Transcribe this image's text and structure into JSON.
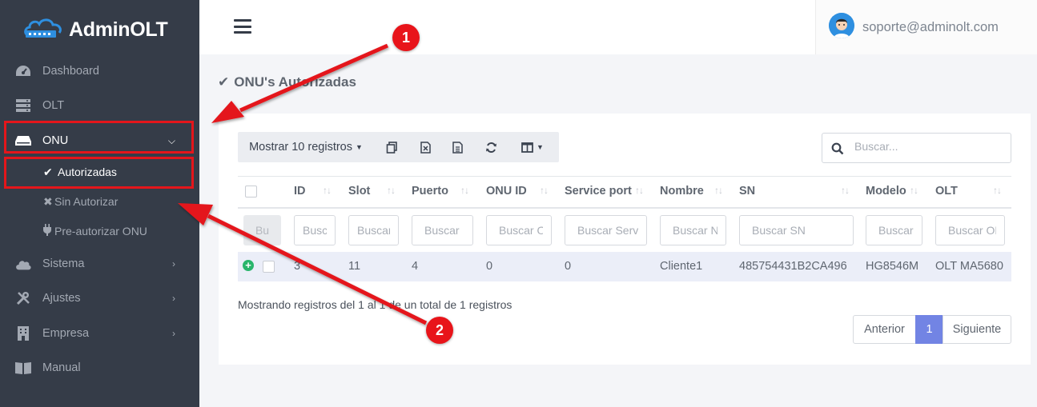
{
  "brand": {
    "name": "AdminOLT"
  },
  "sidebar": {
    "items": [
      {
        "label": "Dashboard",
        "icon": "dashboard-icon"
      },
      {
        "label": "OLT",
        "icon": "server-icon"
      },
      {
        "label": "ONU",
        "icon": "router-icon",
        "expanded": true
      },
      {
        "label": "Sistema",
        "icon": "cloud-icon"
      },
      {
        "label": "Ajustes",
        "icon": "tools-icon"
      },
      {
        "label": "Empresa",
        "icon": "building-icon"
      },
      {
        "label": "Manual",
        "icon": "book-icon"
      }
    ],
    "sub_items": [
      {
        "label": "Autorizadas",
        "icon": "check-icon",
        "active": true
      },
      {
        "label": "Sin Autorizar",
        "icon": "x-icon"
      },
      {
        "label": "Pre-autorizar ONU",
        "icon": "plug-icon"
      }
    ]
  },
  "header": {
    "user_email": "soporte@adminolt.com"
  },
  "page": {
    "title": "ONU's Autorizadas"
  },
  "toolbar": {
    "page_length_label": "Mostrar 10 registros"
  },
  "search": {
    "placeholder": "Buscar..."
  },
  "table": {
    "columns": [
      "ID",
      "Slot",
      "Puerto",
      "ONU ID",
      "Service port",
      "Nombre",
      "SN",
      "Modelo",
      "OLT"
    ],
    "filter_placeholders": [
      "Bu",
      "Buscar ID",
      "Buscar Slot",
      "Buscar",
      "Buscar ONU ID",
      "Buscar Service port",
      "Buscar Nombre",
      "Buscar SN",
      "Buscar Modelo",
      "Buscar OLT"
    ],
    "rows": [
      {
        "id": "3",
        "slot": "11",
        "puerto": "4",
        "onu_id": "0",
        "service_port": "0",
        "nombre": "Cliente1",
        "sn": "485754431B2CA496",
        "modelo": "HG8546M",
        "olt": "OLT MA5680"
      }
    ],
    "info": "Mostrando registros del 1 al 1 de un total de 1 registros"
  },
  "pagination": {
    "prev": "Anterior",
    "current": "1",
    "next": "Siguiente"
  },
  "annotations": {
    "badge_1": "1",
    "badge_2": "2",
    "color": "#e4161b"
  },
  "colors": {
    "sidebar_bg": "#353c48",
    "accent": "#7284e4",
    "highlight_row": "#ebeef8"
  }
}
